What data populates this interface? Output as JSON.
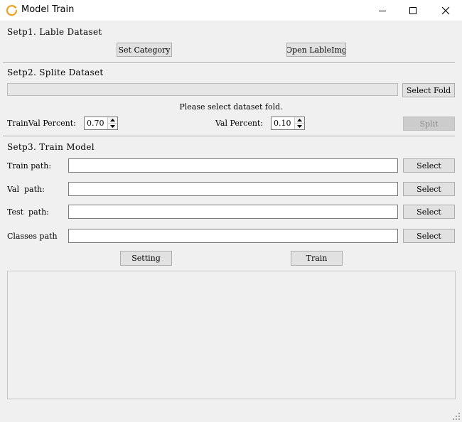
{
  "window": {
    "title": "Model Train"
  },
  "step1": {
    "title": "Setp1. Lable Dataset",
    "set_category": "Set Category",
    "open_labelimg": "Open LableImg"
  },
  "step2": {
    "title": "Setp2. Splite Dataset",
    "progress_value": 0,
    "select_fold": "Select Fold",
    "status": "Please select dataset fold.",
    "trainval_label": "TrainVal Percent:",
    "trainval_value": "0.70",
    "val_label": "Val Percent:",
    "val_value": "0.10",
    "split": "Split"
  },
  "step3": {
    "title": "Setp3. Train Model",
    "rows": [
      {
        "label": "Train path:",
        "value": "",
        "button": "Select"
      },
      {
        "label": "Val  path:",
        "value": "",
        "button": "Select"
      },
      {
        "label": "Test  path:",
        "value": "",
        "button": "Select"
      },
      {
        "label": "Classes path",
        "value": "",
        "button": "Select"
      }
    ],
    "setting": "Setting",
    "train": "Train"
  },
  "log": {
    "text": ""
  }
}
